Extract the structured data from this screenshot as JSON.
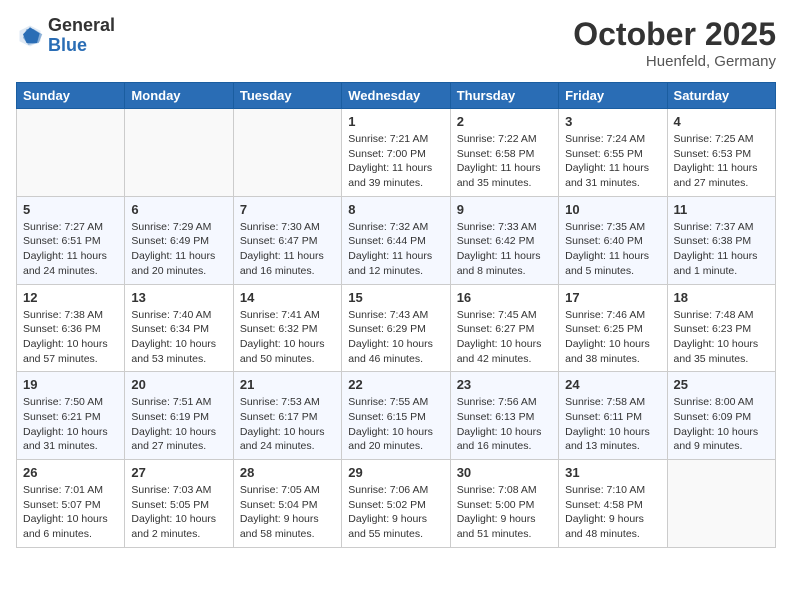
{
  "header": {
    "logo_general": "General",
    "logo_blue": "Blue",
    "month": "October 2025",
    "location": "Huenfeld, Germany"
  },
  "weekdays": [
    "Sunday",
    "Monday",
    "Tuesday",
    "Wednesday",
    "Thursday",
    "Friday",
    "Saturday"
  ],
  "weeks": [
    [
      {
        "day": "",
        "info": ""
      },
      {
        "day": "",
        "info": ""
      },
      {
        "day": "",
        "info": ""
      },
      {
        "day": "1",
        "info": "Sunrise: 7:21 AM\nSunset: 7:00 PM\nDaylight: 11 hours\nand 39 minutes."
      },
      {
        "day": "2",
        "info": "Sunrise: 7:22 AM\nSunset: 6:58 PM\nDaylight: 11 hours\nand 35 minutes."
      },
      {
        "day": "3",
        "info": "Sunrise: 7:24 AM\nSunset: 6:55 PM\nDaylight: 11 hours\nand 31 minutes."
      },
      {
        "day": "4",
        "info": "Sunrise: 7:25 AM\nSunset: 6:53 PM\nDaylight: 11 hours\nand 27 minutes."
      }
    ],
    [
      {
        "day": "5",
        "info": "Sunrise: 7:27 AM\nSunset: 6:51 PM\nDaylight: 11 hours\nand 24 minutes."
      },
      {
        "day": "6",
        "info": "Sunrise: 7:29 AM\nSunset: 6:49 PM\nDaylight: 11 hours\nand 20 minutes."
      },
      {
        "day": "7",
        "info": "Sunrise: 7:30 AM\nSunset: 6:47 PM\nDaylight: 11 hours\nand 16 minutes."
      },
      {
        "day": "8",
        "info": "Sunrise: 7:32 AM\nSunset: 6:44 PM\nDaylight: 11 hours\nand 12 minutes."
      },
      {
        "day": "9",
        "info": "Sunrise: 7:33 AM\nSunset: 6:42 PM\nDaylight: 11 hours\nand 8 minutes."
      },
      {
        "day": "10",
        "info": "Sunrise: 7:35 AM\nSunset: 6:40 PM\nDaylight: 11 hours\nand 5 minutes."
      },
      {
        "day": "11",
        "info": "Sunrise: 7:37 AM\nSunset: 6:38 PM\nDaylight: 11 hours\nand 1 minute."
      }
    ],
    [
      {
        "day": "12",
        "info": "Sunrise: 7:38 AM\nSunset: 6:36 PM\nDaylight: 10 hours\nand 57 minutes."
      },
      {
        "day": "13",
        "info": "Sunrise: 7:40 AM\nSunset: 6:34 PM\nDaylight: 10 hours\nand 53 minutes."
      },
      {
        "day": "14",
        "info": "Sunrise: 7:41 AM\nSunset: 6:32 PM\nDaylight: 10 hours\nand 50 minutes."
      },
      {
        "day": "15",
        "info": "Sunrise: 7:43 AM\nSunset: 6:29 PM\nDaylight: 10 hours\nand 46 minutes."
      },
      {
        "day": "16",
        "info": "Sunrise: 7:45 AM\nSunset: 6:27 PM\nDaylight: 10 hours\nand 42 minutes."
      },
      {
        "day": "17",
        "info": "Sunrise: 7:46 AM\nSunset: 6:25 PM\nDaylight: 10 hours\nand 38 minutes."
      },
      {
        "day": "18",
        "info": "Sunrise: 7:48 AM\nSunset: 6:23 PM\nDaylight: 10 hours\nand 35 minutes."
      }
    ],
    [
      {
        "day": "19",
        "info": "Sunrise: 7:50 AM\nSunset: 6:21 PM\nDaylight: 10 hours\nand 31 minutes."
      },
      {
        "day": "20",
        "info": "Sunrise: 7:51 AM\nSunset: 6:19 PM\nDaylight: 10 hours\nand 27 minutes."
      },
      {
        "day": "21",
        "info": "Sunrise: 7:53 AM\nSunset: 6:17 PM\nDaylight: 10 hours\nand 24 minutes."
      },
      {
        "day": "22",
        "info": "Sunrise: 7:55 AM\nSunset: 6:15 PM\nDaylight: 10 hours\nand 20 minutes."
      },
      {
        "day": "23",
        "info": "Sunrise: 7:56 AM\nSunset: 6:13 PM\nDaylight: 10 hours\nand 16 minutes."
      },
      {
        "day": "24",
        "info": "Sunrise: 7:58 AM\nSunset: 6:11 PM\nDaylight: 10 hours\nand 13 minutes."
      },
      {
        "day": "25",
        "info": "Sunrise: 8:00 AM\nSunset: 6:09 PM\nDaylight: 10 hours\nand 9 minutes."
      }
    ],
    [
      {
        "day": "26",
        "info": "Sunrise: 7:01 AM\nSunset: 5:07 PM\nDaylight: 10 hours\nand 6 minutes."
      },
      {
        "day": "27",
        "info": "Sunrise: 7:03 AM\nSunset: 5:05 PM\nDaylight: 10 hours\nand 2 minutes."
      },
      {
        "day": "28",
        "info": "Sunrise: 7:05 AM\nSunset: 5:04 PM\nDaylight: 9 hours\nand 58 minutes."
      },
      {
        "day": "29",
        "info": "Sunrise: 7:06 AM\nSunset: 5:02 PM\nDaylight: 9 hours\nand 55 minutes."
      },
      {
        "day": "30",
        "info": "Sunrise: 7:08 AM\nSunset: 5:00 PM\nDaylight: 9 hours\nand 51 minutes."
      },
      {
        "day": "31",
        "info": "Sunrise: 7:10 AM\nSunset: 4:58 PM\nDaylight: 9 hours\nand 48 minutes."
      },
      {
        "day": "",
        "info": ""
      }
    ]
  ]
}
